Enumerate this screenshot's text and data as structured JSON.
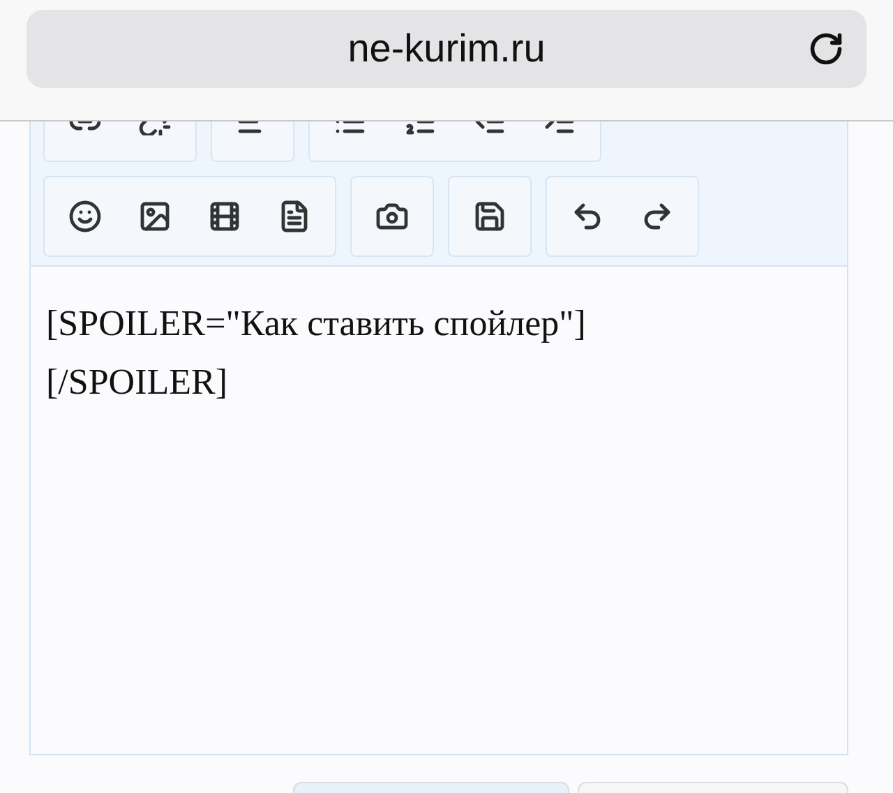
{
  "address_bar": {
    "url": "ne-kurim.ru"
  },
  "editor": {
    "lines": [
      "[SPOILER=\"Как ставить спойлер\"]",
      "[/SPOILER]"
    ]
  }
}
